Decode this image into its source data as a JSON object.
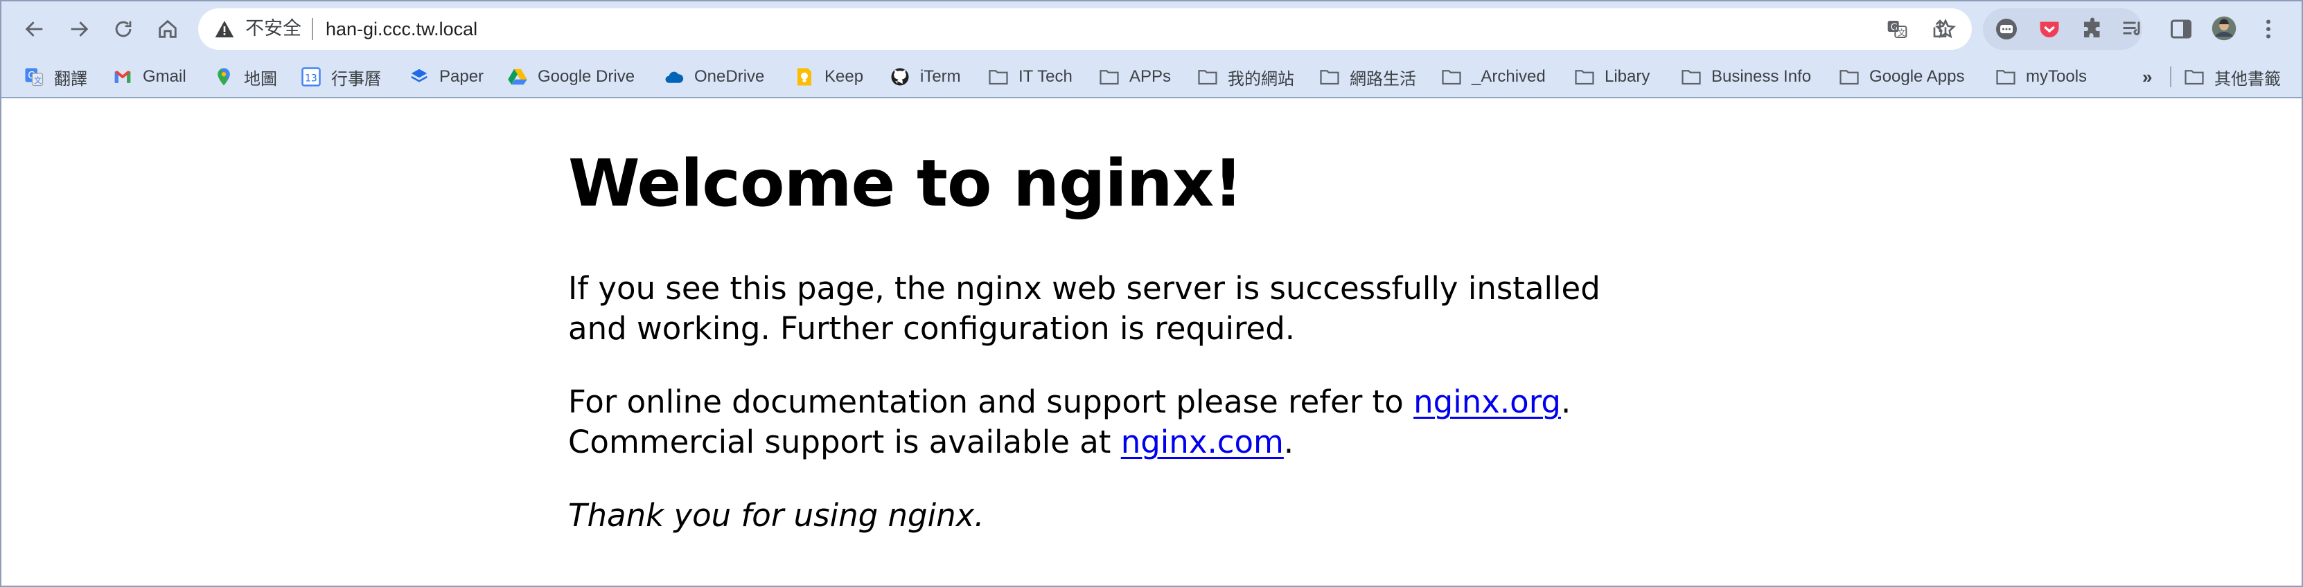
{
  "browser": {
    "address_bar": {
      "security_label": "不安全",
      "url": "han-gi.ccc.tw.local"
    },
    "icons": {
      "back": "back-arrow-icon",
      "forward": "forward-arrow-icon",
      "reload": "reload-icon",
      "home": "home-icon",
      "not_secure": "warning-triangle-icon",
      "translate": "translate-icon",
      "share": "share-icon",
      "bookmark_star": "star-icon",
      "profile": "avatar"
    },
    "bookmarks": [
      {
        "label": "翻譯",
        "icon": "google-translate-icon"
      },
      {
        "label": "Gmail",
        "icon": "gmail-icon"
      },
      {
        "label": "地圖",
        "icon": "google-maps-icon"
      },
      {
        "label": "行事曆",
        "icon": "google-calendar-icon"
      },
      {
        "label": "Paper",
        "icon": "dropbox-paper-icon"
      },
      {
        "label": "Google Drive",
        "icon": "google-drive-icon"
      },
      {
        "label": "OneDrive",
        "icon": "onedrive-icon"
      },
      {
        "label": "Keep",
        "icon": "google-keep-icon"
      },
      {
        "label": "iTerm",
        "icon": "github-icon"
      },
      {
        "label": "IT Tech",
        "icon": "folder-icon"
      },
      {
        "label": "APPs",
        "icon": "folder-icon"
      },
      {
        "label": "我的網站",
        "icon": "folder-icon"
      },
      {
        "label": "網路生活",
        "icon": "folder-icon"
      },
      {
        "label": "_Archived",
        "icon": "folder-icon"
      },
      {
        "label": "Libary",
        "icon": "folder-icon"
      },
      {
        "label": "Business Info",
        "icon": "folder-icon"
      },
      {
        "label": "Google Apps",
        "icon": "folder-icon"
      },
      {
        "label": "myTools",
        "icon": "folder-icon"
      }
    ],
    "bookmarks_overflow": "»",
    "other_bookmarks": "其他書籤",
    "calendar_day": "13"
  },
  "page": {
    "heading": "Welcome to nginx!",
    "para1": "If you see this page, the nginx web server is successfully installed and working. Further configuration is required.",
    "para2_text1": "For online documentation and support please refer to ",
    "link_org": "nginx.org",
    "para2_text2": ".",
    "para2_text3": "Commercial support is available at ",
    "link_com": "nginx.com",
    "para2_text4": ".",
    "para3": "Thank you for using nginx."
  },
  "colors": {
    "toolbar_bg": "#d9e4f7",
    "link": "#0000ee",
    "window_border": "#8d9cb7"
  }
}
